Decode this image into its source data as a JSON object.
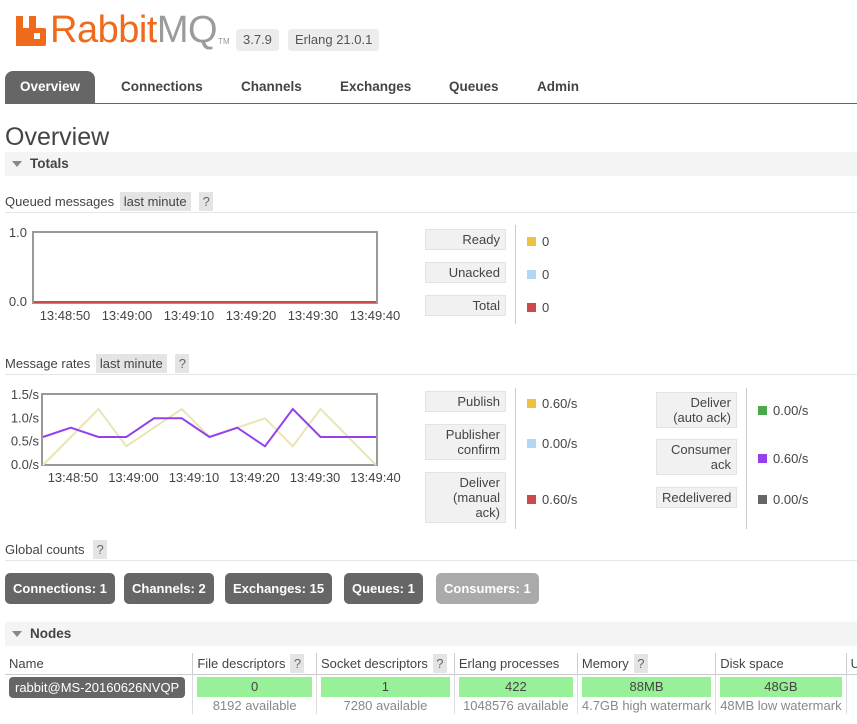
{
  "header": {
    "brand_main": "Rabbit",
    "brand_accent": "MQ",
    "brand_tm": "TM",
    "version": "3.7.9",
    "erlang": "Erlang 21.0.1"
  },
  "tabs": [
    {
      "label": "Overview",
      "active": true
    },
    {
      "label": "Connections"
    },
    {
      "label": "Channels"
    },
    {
      "label": "Exchanges"
    },
    {
      "label": "Queues"
    },
    {
      "label": "Admin"
    }
  ],
  "page_title": "Overview",
  "totals": {
    "heading": "Totals",
    "queued": {
      "title": "Queued messages",
      "range": "last minute",
      "help": "?",
      "legend": [
        {
          "label": "Ready",
          "value": "0",
          "color": "#edc240"
        },
        {
          "label": "Unacked",
          "value": "0",
          "color": "#afd8f8"
        },
        {
          "label": "Total",
          "value": "0",
          "color": "#cb4b4b"
        }
      ]
    },
    "rates": {
      "title": "Message rates",
      "range": "last minute",
      "help": "?",
      "legend_left": [
        {
          "label": "Publish",
          "value": "0.60/s",
          "color": "#edc240"
        },
        {
          "label": "Publisher confirm",
          "value": "0.00/s",
          "color": "#afd8f8"
        },
        {
          "label": "Deliver (manual ack)",
          "value": "0.60/s",
          "color": "#cb4b4b"
        }
      ],
      "legend_right": [
        {
          "label": "Deliver (auto ack)",
          "value": "0.00/s",
          "color": "#4da74d"
        },
        {
          "label": "Consumer ack",
          "value": "0.60/s",
          "color": "#9440ed"
        },
        {
          "label": "Redelivered",
          "value": "0.00/s",
          "color": "#666666"
        }
      ]
    },
    "global_counts": {
      "title": "Global counts",
      "help": "?",
      "items": [
        {
          "label": "Connections: 1"
        },
        {
          "label": "Channels: 2"
        },
        {
          "label": "Exchanges: 15"
        },
        {
          "label": "Queues: 1"
        },
        {
          "label": "Consumers: 1",
          "disabled": true
        }
      ]
    }
  },
  "chart_data": [
    {
      "type": "line",
      "title": "Queued messages",
      "x": [
        "13:48:50",
        "13:49:00",
        "13:49:10",
        "13:49:20",
        "13:49:30",
        "13:49:40"
      ],
      "ylim": [
        0,
        1
      ],
      "yticks": [
        "1.0",
        "0.0"
      ],
      "series": [
        {
          "name": "Total",
          "color": "#cb4b4b",
          "values": [
            0,
            0,
            0,
            0,
            0,
            0
          ]
        }
      ]
    },
    {
      "type": "line",
      "title": "Message rates",
      "x": [
        "13:48:50",
        "13:49:00",
        "13:49:10",
        "13:49:20",
        "13:49:30",
        "13:49:40"
      ],
      "ylim": [
        0,
        1.5
      ],
      "yticks": [
        "1.5/s",
        "1.0/s",
        "0.5/s",
        "0.0/s"
      ],
      "series": [
        {
          "name": "Publish",
          "color": "#e8e5b6",
          "t": [
            0,
            5,
            10,
            15,
            20,
            25,
            30,
            35,
            40,
            45,
            50,
            55,
            60
          ],
          "values": [
            0.0,
            0.6,
            1.2,
            0.4,
            0.8,
            1.2,
            0.6,
            0.8,
            1.0,
            0.4,
            1.2,
            0.6,
            0.0
          ]
        },
        {
          "name": "Consumer ack",
          "color": "#9440ed",
          "t": [
            0,
            5,
            10,
            15,
            20,
            25,
            30,
            35,
            40,
            45,
            50,
            55,
            60
          ],
          "values": [
            0.6,
            0.8,
            0.6,
            0.6,
            1.0,
            1.0,
            0.6,
            0.8,
            0.4,
            1.2,
            0.6,
            0.6,
            0.6
          ]
        }
      ]
    }
  ],
  "nodes": {
    "heading": "Nodes",
    "columns": [
      "Name",
      "File descriptors",
      "Socket descriptors",
      "Erlang processes",
      "Memory",
      "Disk space"
    ],
    "help": "?",
    "rows": [
      {
        "name": "rabbit@MS-20160626NVQP",
        "file_descriptors": {
          "used": "0",
          "available": "8192 available",
          "fill": 0
        },
        "socket_descriptors": {
          "used": "1",
          "available": "7280 available",
          "fill": 0
        },
        "erlang_processes": {
          "used": "422",
          "available": "1048576 available",
          "fill": 0
        },
        "memory": {
          "used": "88MB",
          "available": "4.7GB high watermark",
          "fill": 0.02
        },
        "disk_space": {
          "used": "48GB",
          "available": "48MB low watermark",
          "fill": 1
        }
      }
    ]
  }
}
